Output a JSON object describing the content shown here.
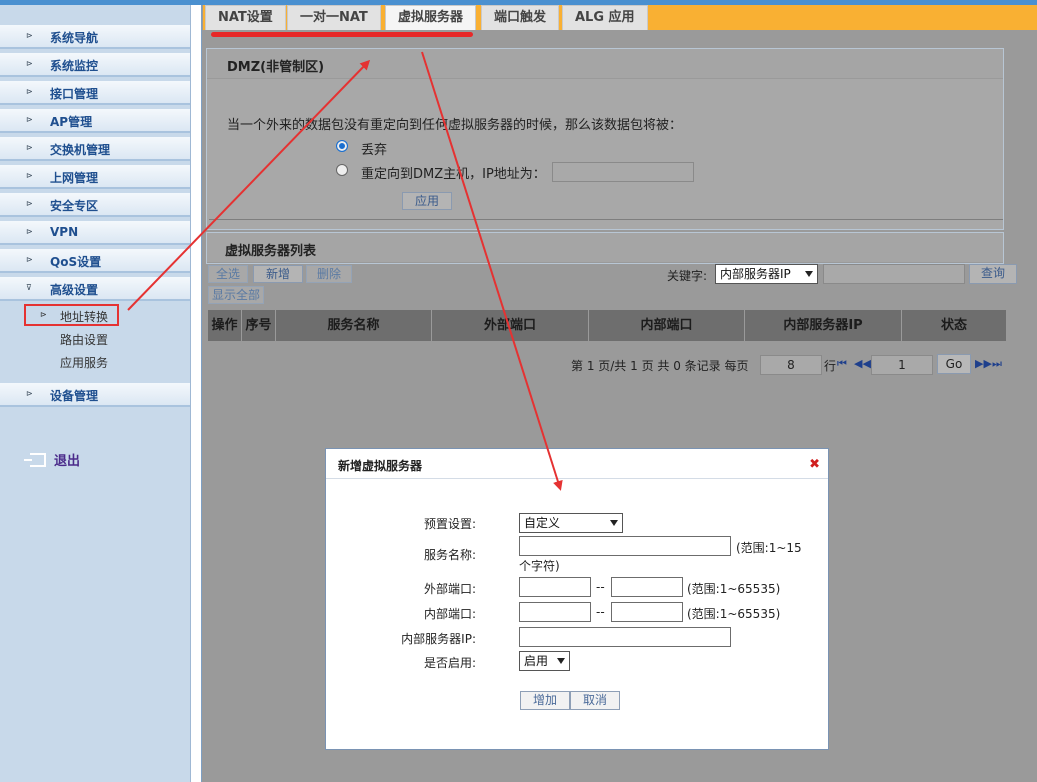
{
  "sidebar": {
    "items": [
      {
        "label": "系统导航"
      },
      {
        "label": "系统监控"
      },
      {
        "label": "接口管理"
      },
      {
        "label": "AP管理"
      },
      {
        "label": "交换机管理"
      },
      {
        "label": "上网管理"
      },
      {
        "label": "安全专区"
      },
      {
        "label": "VPN"
      },
      {
        "label": "QoS设置"
      },
      {
        "label": "高级设置"
      }
    ],
    "sub_items": [
      {
        "label": "地址转换",
        "active": true
      },
      {
        "label": "路由设置"
      },
      {
        "label": "应用服务"
      }
    ],
    "device_mgmt": "设备管理",
    "logout": "退出"
  },
  "tabs": [
    {
      "label": "NAT设置"
    },
    {
      "label": "一对一NAT"
    },
    {
      "label": "虚拟服务器",
      "active": true
    },
    {
      "label": "端口触发"
    },
    {
      "label": "ALG 应用"
    }
  ],
  "dmz": {
    "title": "DMZ(非管制区)",
    "description": "当一个外来的数据包没有重定向到任何虚拟服务器的时候，那么该数据包将被：",
    "option_drop": "丢弃",
    "option_redirect": "重定向到DMZ主机，IP地址为：",
    "apply": "应用"
  },
  "vs_list": {
    "title": "虚拟服务器列表",
    "toolbar": {
      "select_all": "全选",
      "add": "新增",
      "delete": "删除",
      "show_all": "显示全部",
      "keyword_label": "关键字:",
      "keyword_select": "内部服务器IP",
      "search": "查询"
    },
    "columns": [
      "操作",
      "序号",
      "服务名称",
      "外部端口",
      "内部端口",
      "内部服务器IP",
      "状态"
    ],
    "pagination": {
      "summary": "第 1 页/共 1 页 共 0 条记录 每页",
      "per_page": "8",
      "rows_suffix": "行",
      "page": "1",
      "go": "Go"
    }
  },
  "dialog": {
    "title": "新增虚拟服务器",
    "preset_label": "预置设置:",
    "preset_value": "自定义",
    "name_label": "服务名称:",
    "name_hint_1": "(范围:1~15",
    "name_hint_2": "个字符)",
    "ext_port_label": "外部端口:",
    "int_port_label": "内部端口:",
    "port_sep": "--",
    "port_hint": "(范围:1~65535)",
    "server_ip_label": "内部服务器IP:",
    "enable_label": "是否启用:",
    "enable_value": "启用",
    "add_button": "增加",
    "cancel_button": "取消"
  },
  "colors": {
    "tabbar": "#f9b033",
    "annotation": "#e53232",
    "menu_text": "#1f4f8f"
  }
}
